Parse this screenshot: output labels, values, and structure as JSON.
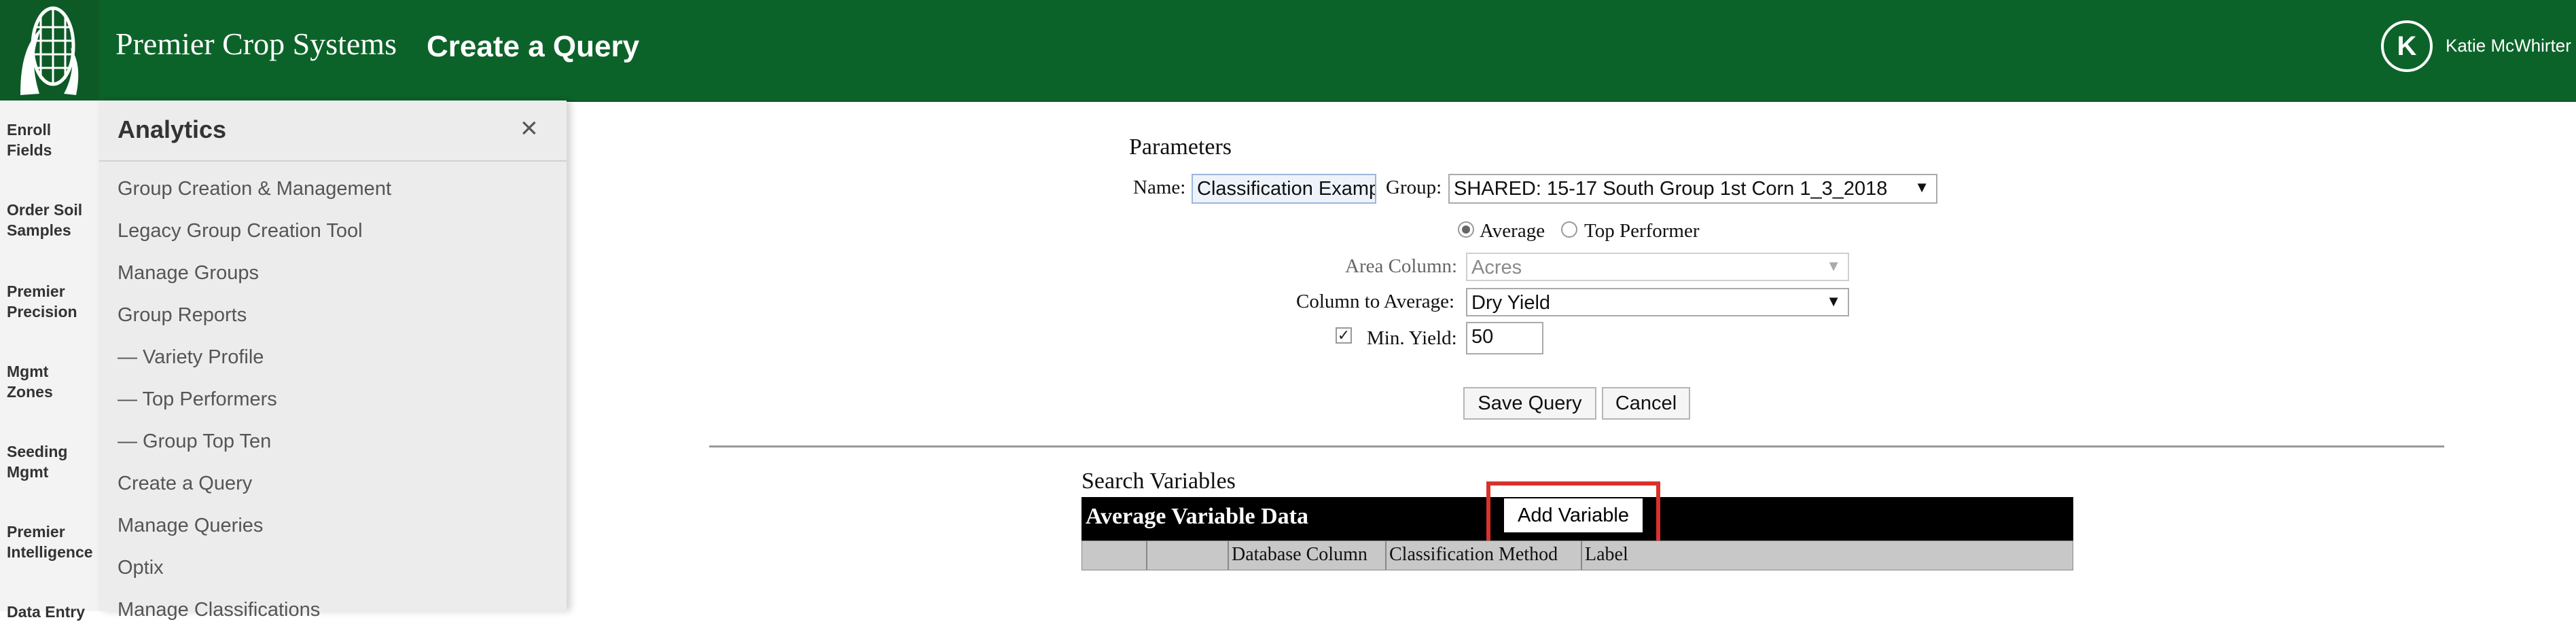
{
  "header": {
    "brand": "Premier Crop Systems",
    "page_title": "Create a Query",
    "user_initial": "K",
    "user_name": "Katie McWhirter"
  },
  "rail": {
    "items": [
      {
        "label": "Enroll Fields"
      },
      {
        "label": "Order Soil Samples"
      },
      {
        "label": "Premier Precision"
      },
      {
        "label": "Mgmt Zones"
      },
      {
        "label": "Seeding Mgmt"
      },
      {
        "label": "Premier Intelligence"
      },
      {
        "label": "Data Entry"
      }
    ]
  },
  "panel": {
    "title": "Analytics",
    "close_icon": "×",
    "links": [
      "Group Creation & Management",
      "Legacy Group Creation Tool",
      "Manage Groups",
      "Group Reports",
      "— Variety Profile",
      "— Top Performers",
      "— Group Top Ten",
      "Create a Query",
      "Manage Queries",
      "Optix",
      "Manage Classifications"
    ]
  },
  "parameters": {
    "heading": "Parameters",
    "name_label": "Name:",
    "name_value": "Classification Example",
    "group_label": "Group:",
    "group_value": "SHARED: 15-17 South Group 1st Corn 1_3_2018",
    "radio_average": "Average",
    "radio_top_performer": "Top Performer",
    "selected_mode": "Average",
    "area_label": "Area Column:",
    "area_value": "Acres",
    "average_label": "Column to Average:",
    "average_value": "Dry Yield",
    "min_yield_label": "Min. Yield:",
    "min_yield_checked": true,
    "min_yield_value": "50",
    "save_label": "Save Query",
    "cancel_label": "Cancel"
  },
  "search": {
    "heading": "Search Variables",
    "table_title": "Average Variable Data",
    "add_variable_label": "Add Variable",
    "columns": [
      "",
      "",
      "Database Column",
      "Classification Method",
      "Label"
    ]
  },
  "colors": {
    "header_green": "#0c6329",
    "highlight_red": "#d9322b"
  }
}
